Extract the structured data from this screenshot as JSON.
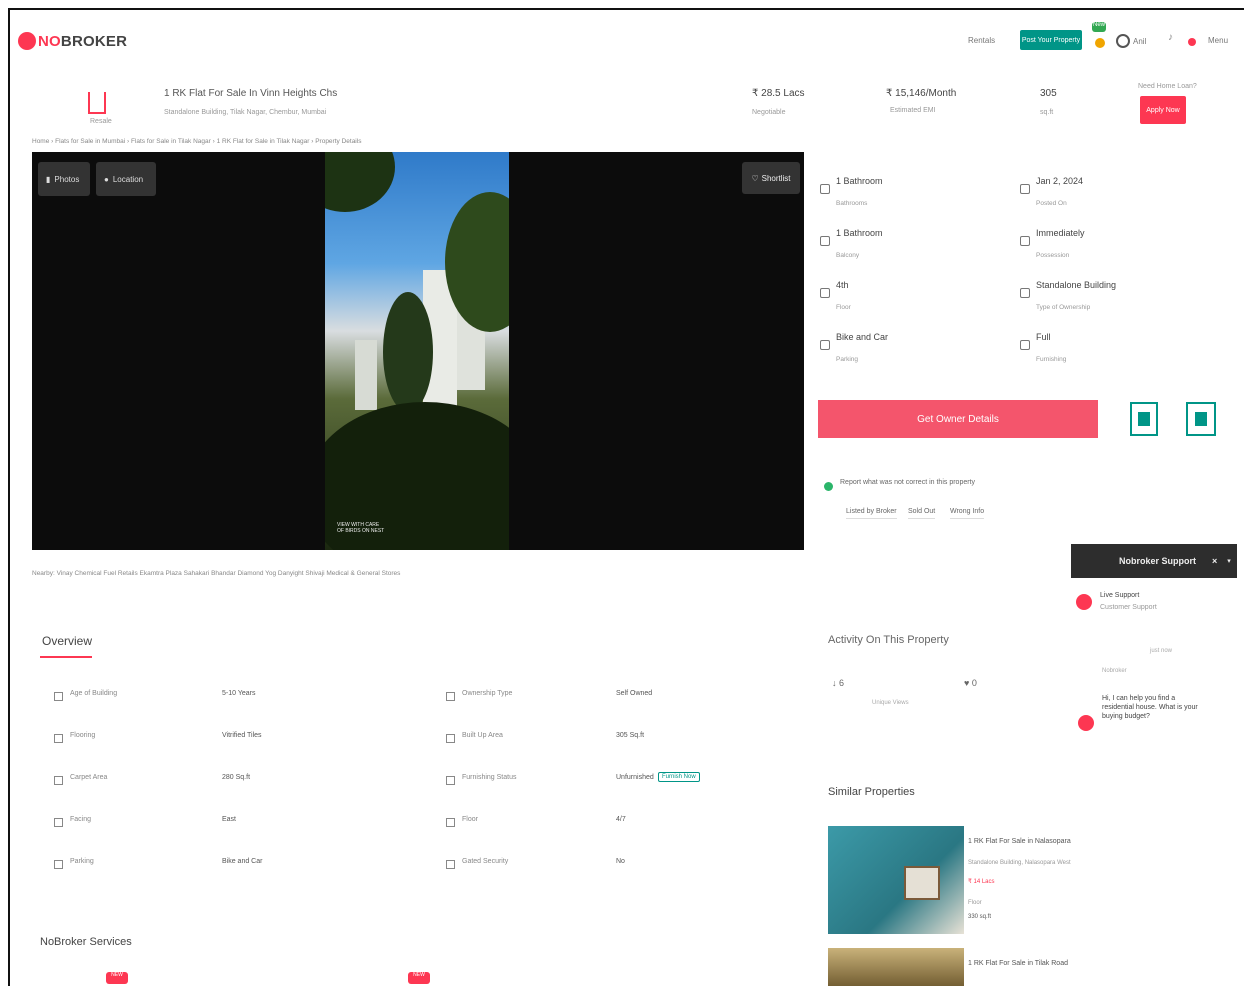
{
  "header": {
    "logo_no": "NO",
    "logo_broker": "BROKER",
    "menu_link": "Rentals",
    "post_property_label": "Post Your Property",
    "new_badge": "New",
    "account_label": "Anil",
    "menu_label": "Menu"
  },
  "summary": {
    "type_label": "Resale",
    "title": "1 RK Flat For Sale In Vinn Heights Chs",
    "address": "Standalone Building, Tilak Nagar, Chembur, Mumbai",
    "price": "₹ 28.5 Lacs",
    "price_sub": "Negotiable",
    "emi": "₹ 15,146/Month",
    "emi_sub": "Estimated EMI",
    "area": "305",
    "area_sub": "sq.ft",
    "help_text": "Need Home Loan?",
    "apply_label": "Apply Now"
  },
  "breadcrumb": "Home › Flats for Sale in Mumbai › Flats for Sale in Tilak Nagar › 1 RK Flat for Sale in Tilak Nagar › Property Details",
  "gallery": {
    "photos_label": "Photos",
    "location_label": "Location",
    "shortlist_label": "Shortlist",
    "caption_line1": "VIEW WITH CARE",
    "caption_line2": "OF BIRDS ON NEST"
  },
  "details": [
    {
      "main": "1 Bathroom",
      "sub": "Bathrooms"
    },
    {
      "main": "Jan 2, 2024",
      "sub": "Posted On"
    },
    {
      "main": "1 Bathroom",
      "sub": "Balcony"
    },
    {
      "main": "Immediately",
      "sub": "Possession"
    },
    {
      "main": "4th",
      "sub": "Floor"
    },
    {
      "main": "Standalone Building",
      "sub": "Type of Ownership"
    },
    {
      "main": "Bike and Car",
      "sub": "Parking"
    },
    {
      "main": "Full",
      "sub": "Furnishing"
    }
  ],
  "owner_button": "Get Owner Details",
  "report": {
    "text": "Report what was not correct in this property",
    "chips": [
      "Listed by Broker",
      "Sold Out",
      "Wrong Info"
    ]
  },
  "support": {
    "bar_label": "Nobroker Support",
    "live_label": "Live Support",
    "live_sub": "Customer Support",
    "just_now": "just now",
    "tag": "Nobroker",
    "bot_message": "Hi, I can help you find a residential house. What is your buying budget?"
  },
  "nearby": "Nearby: Vinay Chemical Fuel Retails   Ekamtra Plaza   Sahakari Bhandar   Diamond Yog Danyight   Shivaji Medical & General Stores",
  "overview": {
    "title": "Overview",
    "rows": [
      {
        "l1": "Age of Building",
        "v1": "5-10 Years",
        "l2": "Ownership Type",
        "v2": "Self Owned"
      },
      {
        "l1": "Flooring",
        "v1": "Vitrified Tiles",
        "l2": "Built Up Area",
        "v2": "305 Sq.ft"
      },
      {
        "l1": "Carpet Area",
        "v1": "280 Sq.ft",
        "l2": "Furnishing Status",
        "v2": "Unfurnished"
      },
      {
        "l1": "Facing",
        "v1": "East",
        "l2": "Floor",
        "v2": "4/7"
      },
      {
        "l1": "Parking",
        "v1": "Bike and Car",
        "l2": "Gated Security",
        "v2": "No"
      }
    ],
    "furnish_tag": "Furnish Now"
  },
  "activity": {
    "title": "Activity On This Property",
    "views": "↓ 6",
    "views_sub": "Unique Views",
    "shortlists": "♥ 0"
  },
  "similar": {
    "title": "Similar Properties",
    "items": [
      {
        "title": "1 RK Flat For Sale in Nalasopara",
        "sub": "Standalone Building, Nalasopara West",
        "price": "₹ 14 Lacs",
        "meta": "Floor",
        "area": "330 sq.ft"
      },
      {
        "title": "1 RK Flat For Sale in Tilak Road",
        "sub": "",
        "price": "",
        "meta": "",
        "area": ""
      }
    ]
  },
  "services": {
    "title": "NoBroker Services",
    "badge": "NEW"
  },
  "colors": {
    "brand_red": "#fd3752",
    "brand_green": "#009587"
  }
}
